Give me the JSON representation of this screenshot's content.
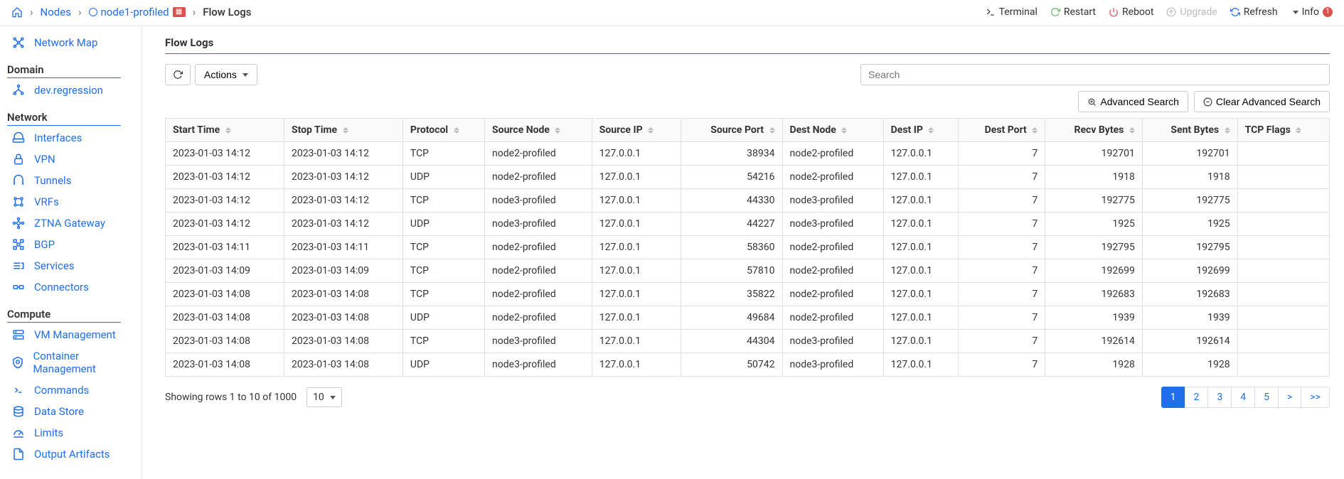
{
  "breadcrumb": {
    "nodes": "Nodes",
    "node": "node1-profiled",
    "current": "Flow Logs"
  },
  "topactions": {
    "terminal": "Terminal",
    "restart": "Restart",
    "reboot": "Reboot",
    "upgrade": "Upgrade",
    "refresh": "Refresh",
    "info": "Info",
    "info_count": "1"
  },
  "sidebar": {
    "top_items": [
      {
        "label": "Network Map",
        "icon": "network-map"
      }
    ],
    "sections": [
      {
        "title": "Domain",
        "items": [
          {
            "label": "dev.regression",
            "icon": "domain"
          }
        ]
      },
      {
        "title": "Network",
        "items": [
          {
            "label": "Interfaces",
            "icon": "interfaces"
          },
          {
            "label": "VPN",
            "icon": "vpn"
          },
          {
            "label": "Tunnels",
            "icon": "tunnels"
          },
          {
            "label": "VRFs",
            "icon": "vrfs"
          },
          {
            "label": "ZTNA Gateway",
            "icon": "ztna"
          },
          {
            "label": "BGP",
            "icon": "bgp"
          },
          {
            "label": "Services",
            "icon": "services"
          },
          {
            "label": "Connectors",
            "icon": "connectors"
          }
        ]
      },
      {
        "title": "Compute",
        "items": [
          {
            "label": "VM Management",
            "icon": "vm"
          },
          {
            "label": "Container Management",
            "icon": "container"
          },
          {
            "label": "Commands",
            "icon": "commands"
          },
          {
            "label": "Data Store",
            "icon": "datastore"
          },
          {
            "label": "Limits",
            "icon": "limits"
          },
          {
            "label": "Output Artifacts",
            "icon": "artifacts"
          }
        ]
      }
    ]
  },
  "page": {
    "title": "Flow Logs",
    "actions_label": "Actions",
    "search_placeholder": "Search",
    "adv_search": "Advanced Search",
    "clear_adv_search": "Clear Advanced Search"
  },
  "table": {
    "columns": [
      {
        "label": "Start Time",
        "align": "left"
      },
      {
        "label": "Stop Time",
        "align": "left"
      },
      {
        "label": "Protocol",
        "align": "left"
      },
      {
        "label": "Source Node",
        "align": "left"
      },
      {
        "label": "Source IP",
        "align": "left"
      },
      {
        "label": "Source Port",
        "align": "right"
      },
      {
        "label": "Dest Node",
        "align": "left"
      },
      {
        "label": "Dest IP",
        "align": "left"
      },
      {
        "label": "Dest Port",
        "align": "right"
      },
      {
        "label": "Recv Bytes",
        "align": "right"
      },
      {
        "label": "Sent Bytes",
        "align": "right"
      },
      {
        "label": "TCP Flags",
        "align": "left"
      }
    ],
    "rows": [
      [
        "2023-01-03 14:12",
        "2023-01-03 14:12",
        "TCP",
        "node2-profiled",
        "127.0.0.1",
        "38934",
        "node2-profiled",
        "127.0.0.1",
        "7",
        "192701",
        "192701",
        ""
      ],
      [
        "2023-01-03 14:12",
        "2023-01-03 14:12",
        "UDP",
        "node2-profiled",
        "127.0.0.1",
        "54216",
        "node2-profiled",
        "127.0.0.1",
        "7",
        "1918",
        "1918",
        ""
      ],
      [
        "2023-01-03 14:12",
        "2023-01-03 14:12",
        "TCP",
        "node3-profiled",
        "127.0.0.1",
        "44330",
        "node3-profiled",
        "127.0.0.1",
        "7",
        "192775",
        "192775",
        ""
      ],
      [
        "2023-01-03 14:12",
        "2023-01-03 14:12",
        "UDP",
        "node3-profiled",
        "127.0.0.1",
        "44227",
        "node3-profiled",
        "127.0.0.1",
        "7",
        "1925",
        "1925",
        ""
      ],
      [
        "2023-01-03 14:11",
        "2023-01-03 14:11",
        "TCP",
        "node2-profiled",
        "127.0.0.1",
        "58360",
        "node2-profiled",
        "127.0.0.1",
        "7",
        "192795",
        "192795",
        ""
      ],
      [
        "2023-01-03 14:09",
        "2023-01-03 14:09",
        "TCP",
        "node2-profiled",
        "127.0.0.1",
        "57810",
        "node2-profiled",
        "127.0.0.1",
        "7",
        "192699",
        "192699",
        ""
      ],
      [
        "2023-01-03 14:08",
        "2023-01-03 14:08",
        "TCP",
        "node2-profiled",
        "127.0.0.1",
        "35822",
        "node2-profiled",
        "127.0.0.1",
        "7",
        "192683",
        "192683",
        ""
      ],
      [
        "2023-01-03 14:08",
        "2023-01-03 14:08",
        "UDP",
        "node2-profiled",
        "127.0.0.1",
        "49684",
        "node2-profiled",
        "127.0.0.1",
        "7",
        "1939",
        "1939",
        ""
      ],
      [
        "2023-01-03 14:08",
        "2023-01-03 14:08",
        "TCP",
        "node3-profiled",
        "127.0.0.1",
        "44304",
        "node3-profiled",
        "127.0.0.1",
        "7",
        "192614",
        "192614",
        ""
      ],
      [
        "2023-01-03 14:08",
        "2023-01-03 14:08",
        "UDP",
        "node3-profiled",
        "127.0.0.1",
        "50742",
        "node3-profiled",
        "127.0.0.1",
        "7",
        "1928",
        "1928",
        ""
      ]
    ]
  },
  "footer": {
    "rows_text": "Showing rows 1 to 10 of 1000",
    "page_size": "10",
    "pages": [
      "1",
      "2",
      "3",
      "4",
      "5",
      ">",
      ">>"
    ],
    "active_page": "1"
  }
}
